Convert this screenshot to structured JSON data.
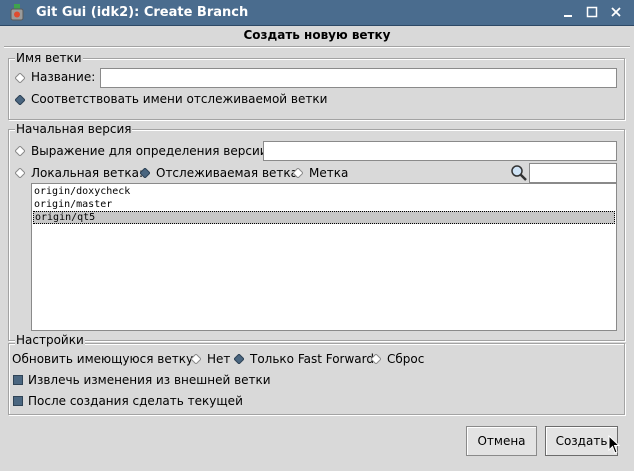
{
  "window": {
    "title": "Git Gui (idk2): Create Branch",
    "icon": "git-gui-icon",
    "controls": [
      "minimize-icon",
      "maximize-icon",
      "close-icon"
    ]
  },
  "header": {
    "title": "Создать новую ветку"
  },
  "branch_name": {
    "legend": "Имя ветки",
    "name_label": "Название:",
    "name_value": "",
    "match_tracking_label": "Соответствовать имени отслеживаемой ветки",
    "selected": "match_tracking"
  },
  "start_revision": {
    "legend": "Начальная версия",
    "expression_label": "Выражение для определения версии:",
    "expression_value": "",
    "local_branch_label": "Локальная ветка:",
    "tracking_branch_label": "Отслеживаемая ветка",
    "tag_label": "Метка",
    "selected": "tracking_branch",
    "filter_value": "",
    "branches": [
      "origin/doxycheck",
      "origin/master",
      "origin/qt5"
    ],
    "selected_branch": "origin/qt5"
  },
  "options": {
    "legend": "Настройки",
    "update_label": "Обновить имеющуюся ветку:",
    "update_no": "Нет",
    "update_ff": "Только Fast Forward",
    "update_reset": "Сброс",
    "update_selected": "ff",
    "fetch_label": "Извлечь изменения из внешней ветки",
    "fetch_checked": true,
    "checkout_label": "После создания сделать текущей",
    "checkout_checked": true
  },
  "buttons": {
    "cancel": "Отмена",
    "create": "Создать"
  },
  "colors": {
    "titlebar": "#4a6c8e",
    "background": "#d9d9d9",
    "indicator": "#4a6680"
  }
}
